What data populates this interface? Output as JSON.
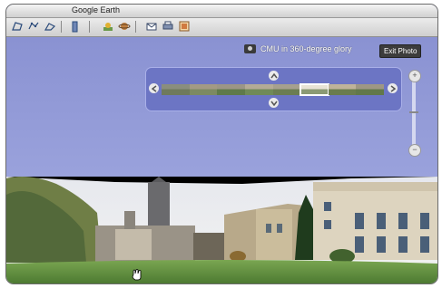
{
  "window": {
    "title": "Google Earth"
  },
  "toolbar": {
    "icons": [
      "placemark-icon",
      "polygon-icon",
      "path-icon",
      "overlay-icon",
      "sun-icon",
      "planet-icon",
      "email-icon",
      "print-icon",
      "maps-icon"
    ]
  },
  "tour": {
    "title": "CMU in 360-degree glory",
    "exit_label": "Exit Photo"
  },
  "navigator": {
    "thumbnail_count": 8,
    "selected_index": 5
  },
  "zoom": {
    "plus": "+",
    "minus": "−"
  },
  "colors": {
    "sky": "#8a92d2",
    "navigator": "#6c75c4",
    "grass": "#6f9a4a"
  }
}
